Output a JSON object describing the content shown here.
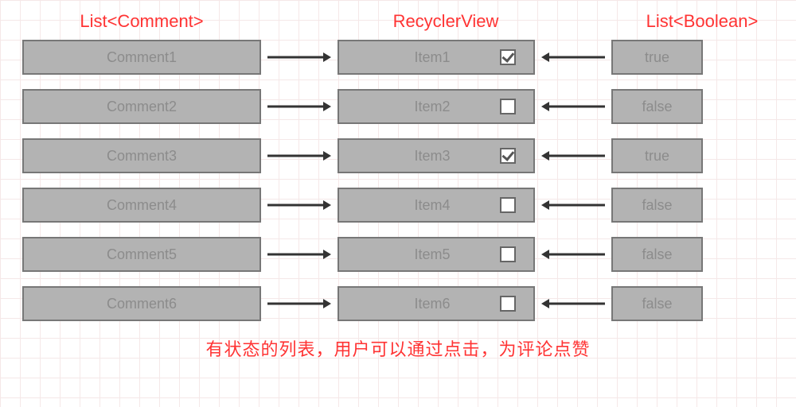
{
  "headers": {
    "left": "List<Comment>",
    "mid": "RecyclerView",
    "right": "List<Boolean>"
  },
  "rows": [
    {
      "comment": "Comment1",
      "item": "Item1",
      "checked": true,
      "bool": "true"
    },
    {
      "comment": "Comment2",
      "item": "Item2",
      "checked": false,
      "bool": "false"
    },
    {
      "comment": "Comment3",
      "item": "Item3",
      "checked": true,
      "bool": "true"
    },
    {
      "comment": "Comment4",
      "item": "Item4",
      "checked": false,
      "bool": "false"
    },
    {
      "comment": "Comment5",
      "item": "Item5",
      "checked": false,
      "bool": "false"
    },
    {
      "comment": "Comment6",
      "item": "Item6",
      "checked": false,
      "bool": "false"
    }
  ],
  "caption": "有状态的列表，用户可以通过点击，为评论点赞",
  "colors": {
    "accent": "#ff3333",
    "box_fill": "#b3b3b3",
    "box_border": "#777"
  }
}
